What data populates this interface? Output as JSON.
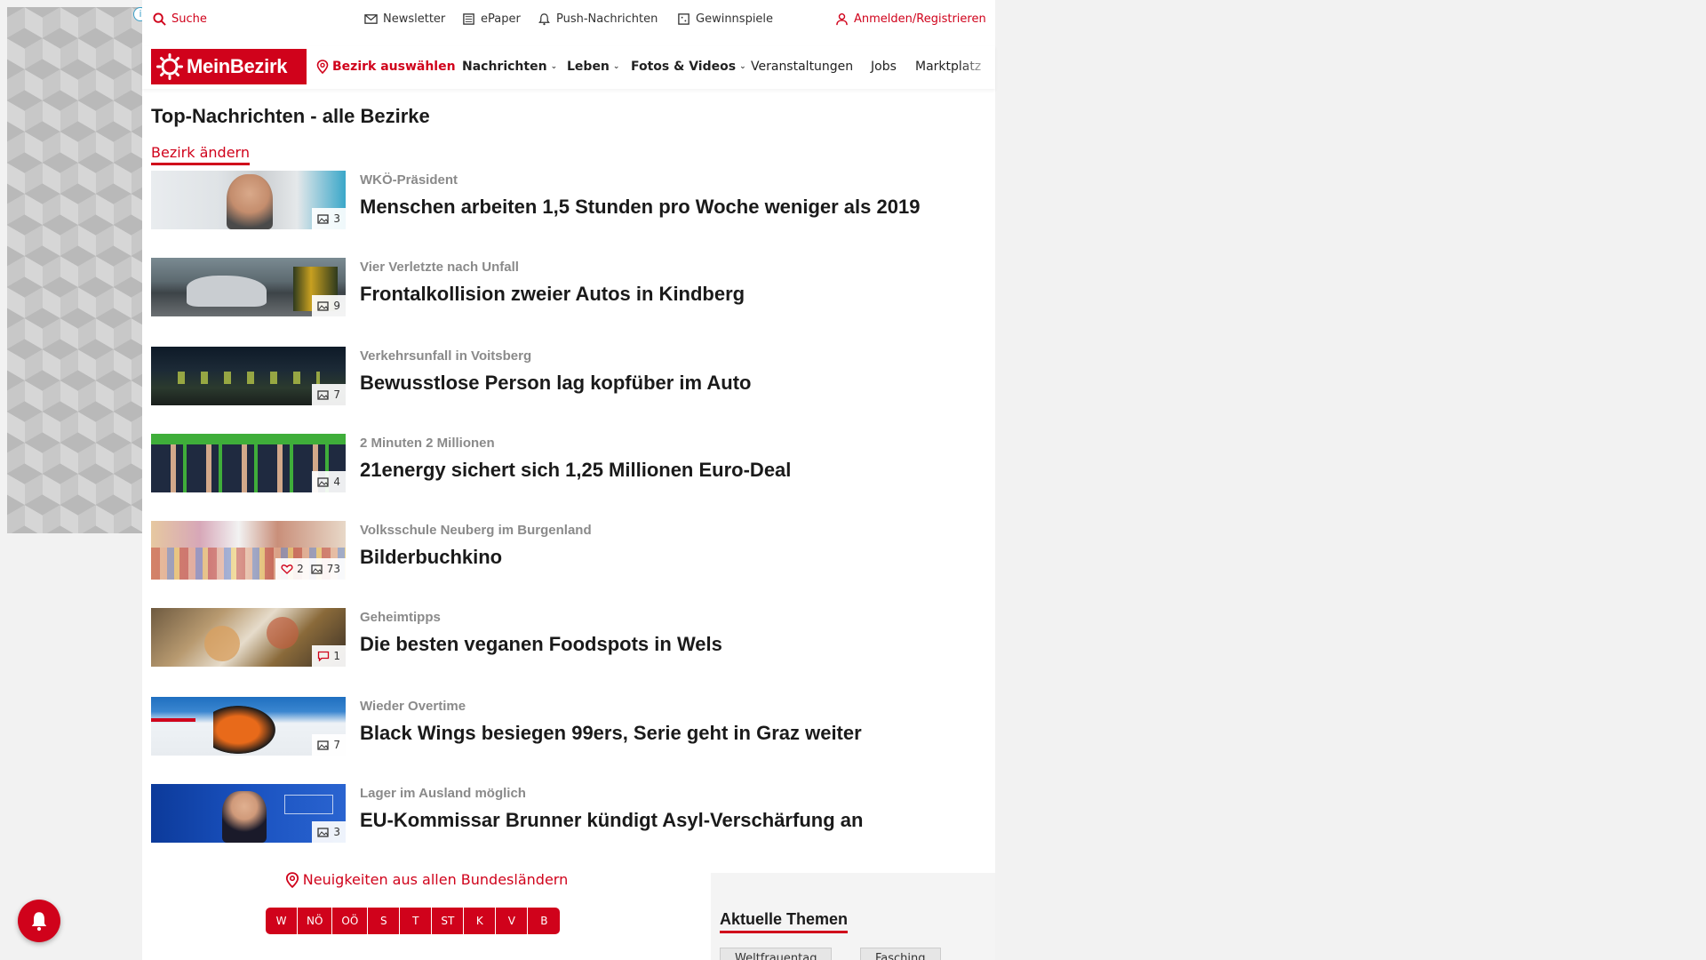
{
  "topbar": {
    "search": "Suche",
    "newsletter": "Newsletter",
    "epaper": "ePaper",
    "push": "Push-Nachrichten",
    "gewinnspiele": "Gewinnspiele",
    "login": "Anmelden/Registrieren"
  },
  "nav": {
    "logo": "MeinBezirk",
    "bezirk": "Bezirk auswählen",
    "items": [
      "Nachrichten",
      "Leben",
      "Fotos & Videos",
      "Veranstaltungen",
      "Jobs",
      "Marktplatz"
    ]
  },
  "main": {
    "title": "Top-Nachrichten - alle Bezirke",
    "change_link": "Bezirk ändern"
  },
  "articles": [
    {
      "kicker": "WKÖ-Präsident",
      "headline": "Menschen arbeiten 1,5 Stunden pro Woche weniger als 2019",
      "photos": "3"
    },
    {
      "kicker": "Vier Verletzte nach Unfall",
      "headline": "Frontalkollision zweier Autos in Kindberg",
      "photos": "9"
    },
    {
      "kicker": "Verkehrsunfall in Voitsberg",
      "headline": "Bewusstlose Person lag kopfüber im Auto",
      "photos": "7"
    },
    {
      "kicker": "2 Minuten 2 Millionen",
      "headline": "21energy sichert sich 1,25 Millionen Euro-Deal",
      "photos": "4"
    },
    {
      "kicker": "Volksschule Neuberg im Burgenland",
      "headline": "Bilderbuchkino",
      "likes": "2",
      "photos": "73"
    },
    {
      "kicker": "Geheimtipps",
      "headline": "Die besten veganen Foodspots in Wels",
      "comments": "1"
    },
    {
      "kicker": "Wieder Overtime",
      "headline": "Black Wings besiegen 99ers, Serie geht in Graz weiter",
      "photos": "7"
    },
    {
      "kicker": "Lager im Ausland möglich",
      "headline": "EU-Kommissar Brunner kündigt Asyl-Verschärfung an",
      "photos": "3"
    }
  ],
  "bundeslaender": {
    "label": "Neuigkeiten aus allen Bundesländern",
    "states": [
      "W",
      "NÖ",
      "OÖ",
      "S",
      "T",
      "ST",
      "K",
      "V",
      "B"
    ]
  },
  "themen": {
    "title": "Aktuelle Themen",
    "tags": [
      "Weltfrauentag",
      "Fasching"
    ]
  },
  "colors": {
    "brand": "#d0021b"
  }
}
